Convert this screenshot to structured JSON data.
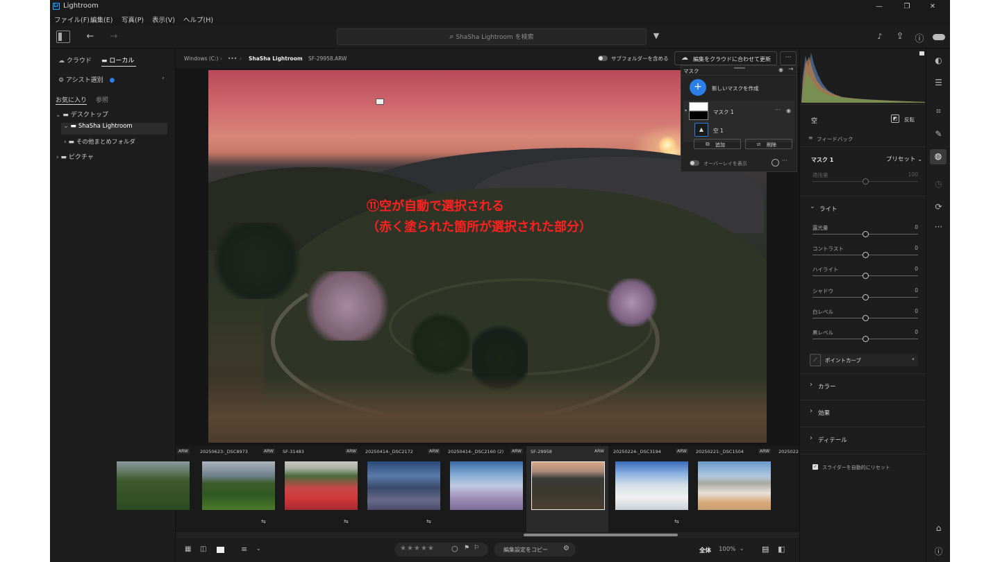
{
  "app": {
    "title": "Lightroom",
    "logo": "Lr"
  },
  "window_controls": {
    "minimize": "—",
    "maximize": "❐",
    "close": "✕"
  },
  "menu": [
    "ファイル(F)",
    "編集(E)",
    "写真(P)",
    "表示(V)",
    "ヘルプ(H)"
  ],
  "search": {
    "placeholder": "ShaSha Lightroom を検索"
  },
  "left": {
    "tabs": {
      "cloud": "クラウド",
      "local": "ローカル"
    },
    "assist": "アシスト選別",
    "subtabs": {
      "favorites": "お気に入り",
      "browse": "参照"
    },
    "tree": [
      "デスクトップ",
      "ShaSha Lightroom",
      "その他まとめフォルダ",
      "ピクチャ"
    ]
  },
  "breadcrumb": {
    "items": [
      "Windows (C:)",
      "•••",
      "ShaSha Lightroom",
      "SF-29958.ARW"
    ],
    "subfolder_toggle": "サブフォルダーを含める",
    "cloud_update_button": "編集をクラウドに合わせて更新",
    "more": "···"
  },
  "annotation": {
    "line1": "⑪空が自動で選択される",
    "line2": "（赤く塗られた箇所が選択された部分）"
  },
  "mask_panel": {
    "title": "マスク",
    "create": "新しいマスクを作成",
    "mask_name": "マスク 1",
    "component": "空 1",
    "add": "追加",
    "remove": "削除",
    "overlay": "オーバーレイを表示",
    "more": "···"
  },
  "filmstrip": {
    "items": [
      {
        "name": "",
        "type": "ARW",
        "sync": false
      },
      {
        "name": "20250623-_DSC8973",
        "type": "ARW",
        "sync": true
      },
      {
        "name": "SF-31483",
        "type": "ARW",
        "sync": true
      },
      {
        "name": "20250414-_DSC2172",
        "type": "ARW",
        "sync": true
      },
      {
        "name": "20250414-_DSC2160 (2)",
        "type": "ARW",
        "sync": false
      },
      {
        "name": "SF-29958",
        "type": "ARW",
        "sync": false
      },
      {
        "name": "20250224-_DSC3194",
        "type": "ARW",
        "sync": true
      },
      {
        "name": "20250221-_DSC1504",
        "type": "ARW",
        "sync": false
      },
      {
        "name": "2025022",
        "type": "",
        "sync": false
      }
    ]
  },
  "bottombar": {
    "stars": "★★★★★",
    "copy_settings": "編集設定をコピー",
    "fit": "全体",
    "zoom": "100%"
  },
  "right": {
    "sky_label": "空",
    "invert": "反転",
    "feedback": "フィードバック",
    "mask_name": "マスク 1",
    "preset": "プリセット",
    "amount_label": "適用量",
    "amount_value": "100",
    "light": "ライト",
    "sliders": [
      {
        "label": "露光量",
        "value": "0"
      },
      {
        "label": "コントラスト",
        "value": "0"
      },
      {
        "label": "ハイライト",
        "value": "0"
      },
      {
        "label": "シャドウ",
        "value": "0"
      },
      {
        "label": "白レベル",
        "value": "0"
      },
      {
        "label": "黒レベル",
        "value": "0"
      }
    ],
    "point_curve": "ポイントカーブ",
    "sections": [
      "カラー",
      "効果",
      "ディテール"
    ],
    "auto_reset": "スライダーを自動的にリセット"
  },
  "colors": {
    "accent": "#2d7fe8",
    "annotation": "#ff2020",
    "panel": "#1d1d1d"
  }
}
